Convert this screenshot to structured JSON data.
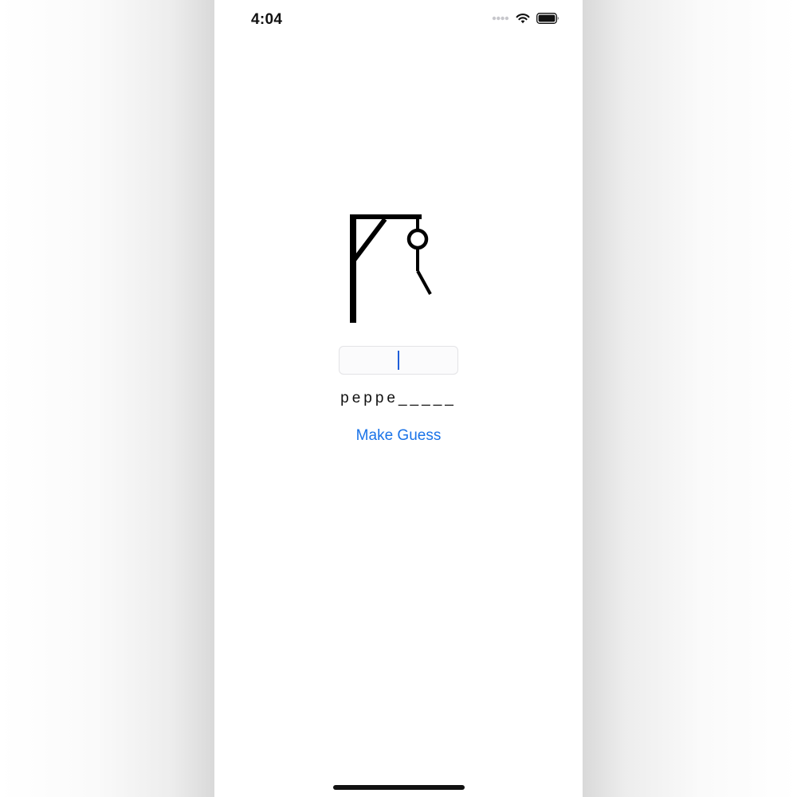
{
  "status_bar": {
    "time": "4:04",
    "icons": [
      "signal-dots-icon",
      "wifi-icon",
      "battery-icon"
    ]
  },
  "game": {
    "hangman_stage": 2,
    "hangman_drawing_icon": "gallows-icon",
    "guess_input": {
      "value": "",
      "placeholder": ""
    },
    "word_display": "peppe_____",
    "make_guess_label": "Make Guess"
  },
  "colors": {
    "accent": "#1a73e8",
    "caret": "#1f5ed9",
    "text": "#111111",
    "background": "#ffffff"
  }
}
